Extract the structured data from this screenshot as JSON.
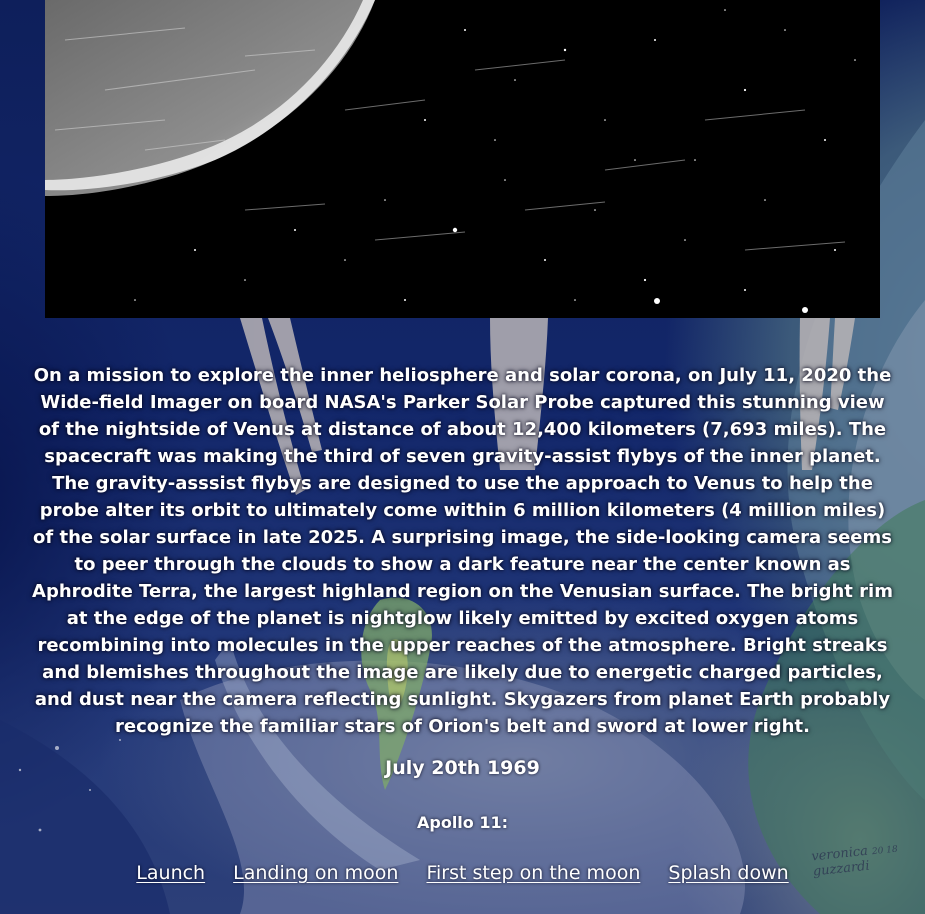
{
  "hero": {
    "alt": "Nightside of Venus imaged by Parker Solar Probe"
  },
  "caption": {
    "text": "On a mission to explore the inner heliosphere and solar corona, on July 11, 2020 the Wide-field Imager on board NASA's Parker Solar Probe captured this stunning view of the nightside of Venus at distance of about 12,400 kilometers (7,693 miles). The spacecraft was making the third of seven gravity-assist flybys of the inner planet. The gravity-asssist flybys are designed to use the approach to Venus to help the probe alter its orbit to ultimately come within 6 million kilometers (4 million miles) of the solar surface in late 2025. A surprising image, the side-looking camera seems to peer through the clouds to show a dark feature near the center known as Aphrodite Terra, the largest highland region on the Venusian surface. The bright rim at the edge of the planet is nightglow likely emitted by excited oxygen atoms recombining into molecules in the upper reaches of the atmosphere. Bright streaks and blemishes throughout the image are likely due to energetic charged particles, and dust near the camera reflecting sunlight. Skygazers from planet Earth probably recognize the familiar stars of Orion's belt and sword at lower right."
  },
  "date_heading": "July 20th 1969",
  "mission_heading": "Apollo 11:",
  "links": [
    {
      "label": "Launch"
    },
    {
      "label": "Landing on moon"
    },
    {
      "label": "First step on the moon"
    },
    {
      "label": "Splash down"
    }
  ],
  "background": {
    "signature_line1": "veronica",
    "signature_line2": "guzzardi",
    "signature_year": "20 18"
  },
  "colors": {
    "background_dark": "#0e1f5b",
    "text": "#ffffff",
    "hero_background": "#000000"
  }
}
